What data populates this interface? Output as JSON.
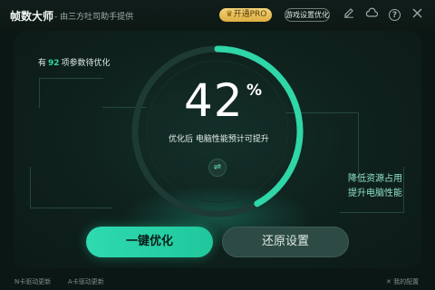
{
  "header": {
    "app_title": "帧数大师",
    "app_subtitle": "- 由三方吐司助手提供",
    "pro_button": "开通PRO",
    "game_settings_button": "游戏设置优化",
    "icons": [
      "edit-icon",
      "cloud-icon",
      "help-icon",
      "close-icon"
    ]
  },
  "main": {
    "params_prefix": "有",
    "params_count": "92",
    "params_suffix": "项参数待优化",
    "percent": "42",
    "percent_sign": "%",
    "progress": 0.42,
    "caption": "优化后 电脑性能预计可提升",
    "side_line1": "降低资源占用",
    "side_line2": "提升电脑性能",
    "primary_button": "一键优化",
    "secondary_button": "还原设置",
    "accent_color": "#2fd6a8"
  },
  "footer": {
    "link_n": "N卡驱动更新",
    "link_a": "A卡驱动更新",
    "my_config": "我的配置"
  }
}
